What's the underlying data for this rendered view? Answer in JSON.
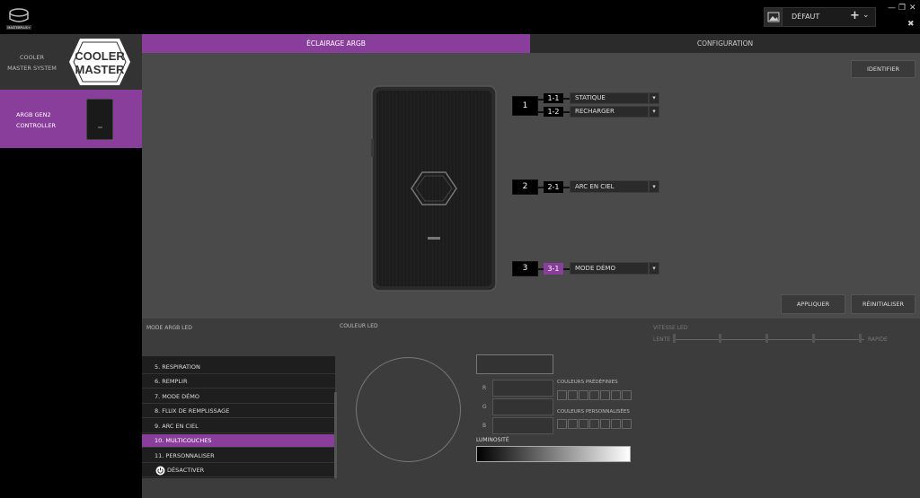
{
  "app": {
    "logo_label": "MASTERPLUS+"
  },
  "profile": {
    "name": "DÉFAUT",
    "add": "+",
    "chevron": "⌄"
  },
  "window": {
    "minimize": "—",
    "restore": "❐",
    "close": "✕",
    "pin": "✖"
  },
  "sidebar": {
    "items": [
      {
        "label": "COOLER MASTER SYSTEM"
      },
      {
        "label_line1": "ARGB GEN2",
        "label_line2": "CONTROLLER",
        "selected": true
      }
    ],
    "brand_logo_line1": "COOLER",
    "brand_logo_line2": "MASTER"
  },
  "tabs": [
    {
      "label": "ÉCLAIRAGE ARGB",
      "active": true
    },
    {
      "label": "CONFIGURATION",
      "active": false
    }
  ],
  "main": {
    "identify_label": "IDENTIFIER",
    "apply_label": "APPLIQUER",
    "reset_label": "RÉINITIALISER",
    "ports": [
      {
        "port": "1",
        "channels": [
          {
            "id": "1-1",
            "effect": "STATIQUE"
          },
          {
            "id": "1-2",
            "effect": "RECHARGER"
          }
        ]
      },
      {
        "port": "2",
        "channels": [
          {
            "id": "2-1",
            "effect": "ARC EN CIEL"
          }
        ]
      },
      {
        "port": "3",
        "channels": [
          {
            "id": "3-1",
            "effect": "MODE DÉMO",
            "active": true
          }
        ]
      }
    ]
  },
  "bottom": {
    "mode_label": "MODE ARGB LED",
    "color_label": "COULEUR LED",
    "speed_label": "VITESSE LED",
    "speed_min": "LENTE",
    "speed_max": "RAPIDE",
    "speed_ticks": 5,
    "modes": [
      {
        "label": "5. RESPIRATION"
      },
      {
        "label": "6. REMPLIR"
      },
      {
        "label": "7. MODE DÉMO"
      },
      {
        "label": "8. FLUX DE REMPLISSAGE"
      },
      {
        "label": "9. ARC EN CIEL"
      },
      {
        "label": "10. MULTICOUCHES",
        "active": true
      },
      {
        "label": "11. PERSONNALISER"
      },
      {
        "label": "DÉSACTIVER"
      }
    ],
    "r_label": "R",
    "g_label": "G",
    "b_label": "B",
    "preset_label": "COULEURS PRÉDÉFINIES",
    "custom_label": "COULEURS PERSONNALISÉES",
    "brightness_label": "LUMINOSITÉ"
  },
  "colors": {
    "accent": "#8a3e9c",
    "panel": "#4a4a4a",
    "bottom": "#3c3c3c"
  }
}
